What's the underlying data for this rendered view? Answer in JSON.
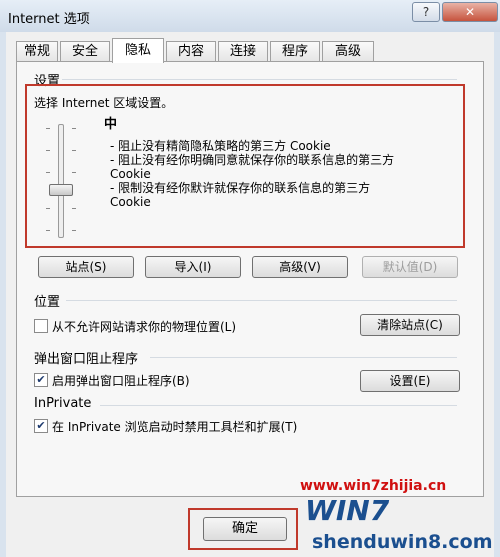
{
  "window": {
    "title": "Internet 选项",
    "help_label": "?",
    "close_label": "✕"
  },
  "tabs": [
    {
      "label": "常规"
    },
    {
      "label": "安全"
    },
    {
      "label": "隐私"
    },
    {
      "label": "内容"
    },
    {
      "label": "连接"
    },
    {
      "label": "程序"
    },
    {
      "label": "高级"
    }
  ],
  "settings": {
    "group_label": "设置",
    "zone_title": "选择 Internet 区域设置。",
    "level": "中",
    "descriptions": [
      "- 阻止没有精简隐私策略的第三方 Cookie",
      "- 阻止没有经你明确同意就保存你的联系信息的第三方\nCookie",
      "- 限制没有经你默许就保存你的联系信息的第三方\nCookie"
    ],
    "buttons": {
      "sites": "站点(S)",
      "import": "导入(I)",
      "advanced": "高级(V)",
      "default": "默认值(D)"
    }
  },
  "location": {
    "group_label": "位置",
    "checkbox_label": "从不允许网站请求你的物理位置(L)",
    "checked": false,
    "clear_button": "清除站点(C)"
  },
  "popup": {
    "group_label": "弹出窗口阻止程序",
    "checkbox_label": "启用弹出窗口阻止程序(B)",
    "checked": true,
    "settings_button": "设置(E)"
  },
  "inprivate": {
    "group_label": "InPrivate",
    "checkbox_label": "在 InPrivate 浏览启动时禁用工具栏和扩展(T)",
    "checked": true
  },
  "footer": {
    "ok_label": "确定"
  },
  "watermark": {
    "url": "www.win7zhijia.cn",
    "logo_text": "WIN7",
    "site": "shenduwin8.com"
  },
  "colors": {
    "highlight_box": "#c0392b",
    "watermark_blue": "#1b4f8f",
    "watermark_red": "#d01010"
  }
}
